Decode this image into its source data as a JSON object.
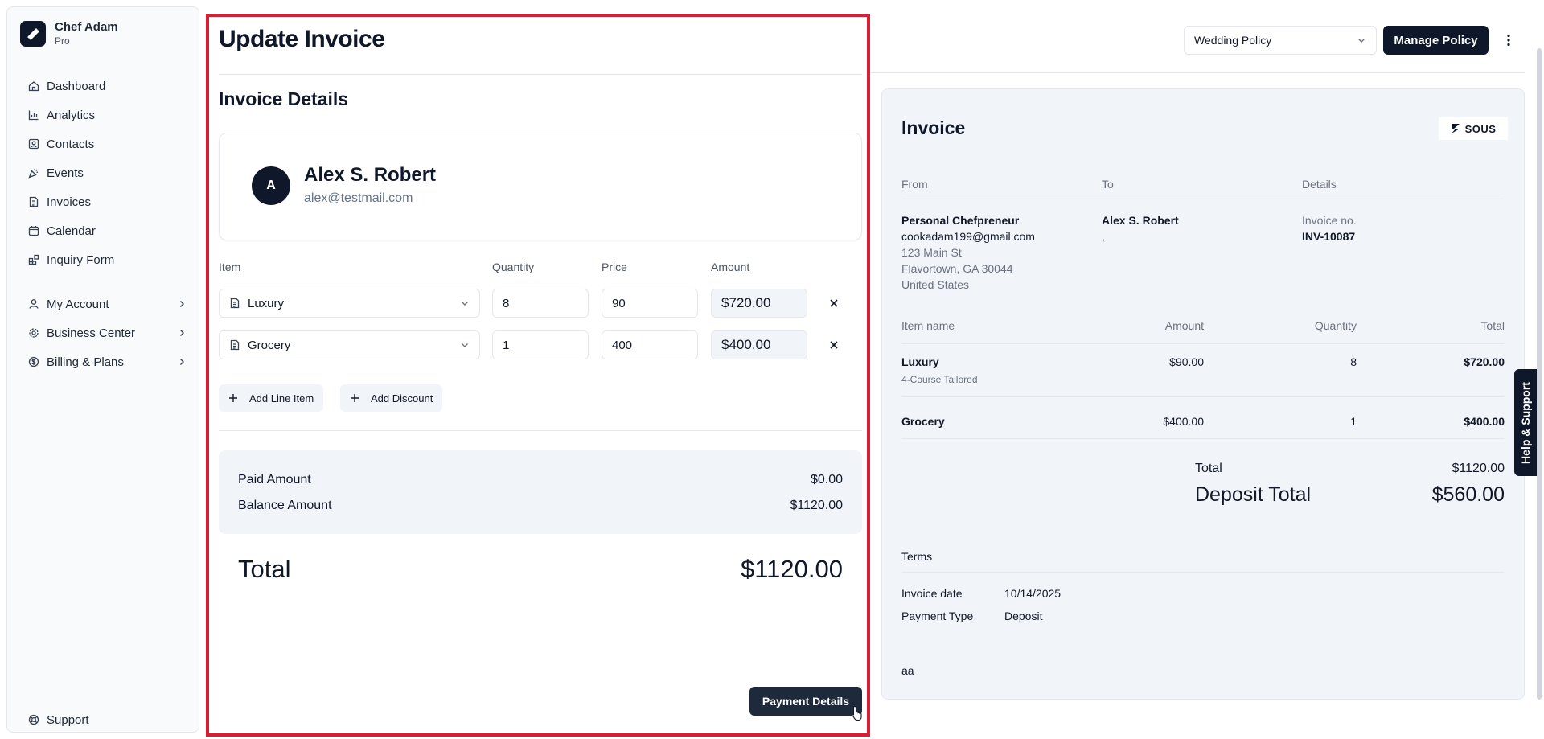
{
  "brand": {
    "name": "Chef Adam",
    "plan": "Pro"
  },
  "nav": {
    "primary": [
      {
        "label": "Dashboard",
        "icon": "home-icon"
      },
      {
        "label": "Analytics",
        "icon": "bar-chart-icon"
      },
      {
        "label": "Contacts",
        "icon": "contact-card-icon"
      },
      {
        "label": "Events",
        "icon": "party-popper-icon"
      },
      {
        "label": "Invoices",
        "icon": "document-icon"
      },
      {
        "label": "Calendar",
        "icon": "calendar-icon"
      },
      {
        "label": "Inquiry Form",
        "icon": "form-blocks-icon"
      }
    ],
    "secondary": [
      {
        "label": "My Account",
        "icon": "user-icon"
      },
      {
        "label": "Business Center",
        "icon": "gear-icon"
      },
      {
        "label": "Billing & Plans",
        "icon": "dollar-circle-icon"
      }
    ],
    "support": {
      "label": "Support",
      "icon": "lifebuoy-icon"
    }
  },
  "header": {
    "policy_select": "Wedding Policy",
    "manage_policy": "Manage Policy"
  },
  "form": {
    "title": "Update Invoice",
    "section_title": "Invoice Details",
    "client": {
      "initial": "A",
      "name": "Alex S. Robert",
      "email": "alex@testmail.com"
    },
    "columns": {
      "item": "Item",
      "quantity": "Quantity",
      "price": "Price",
      "amount": "Amount"
    },
    "lines": [
      {
        "item": "Luxury",
        "quantity": "8",
        "price": "90",
        "amount": "$720.00"
      },
      {
        "item": "Grocery",
        "quantity": "1",
        "price": "400",
        "amount": "$400.00"
      }
    ],
    "add_line_item": "Add Line Item",
    "add_discount": "Add Discount",
    "paid_label": "Paid Amount",
    "paid_value": "$0.00",
    "balance_label": "Balance Amount",
    "balance_value": "$1120.00",
    "total_label": "Total",
    "total_value": "$1120.00",
    "payment_details": "Payment Details"
  },
  "preview": {
    "title": "Invoice",
    "logo_text": "SOUS",
    "headers": {
      "from": "From",
      "to": "To",
      "details": "Details"
    },
    "from": {
      "name": "Personal Chefpreneur",
      "email": "cookadam199@gmail.com",
      "address1": "123 Main St",
      "address2": "Flavortown, GA 30044",
      "country": "United States"
    },
    "to": {
      "name": "Alex S. Robert",
      "line2": ","
    },
    "details": {
      "invoice_no_label": "Invoice no.",
      "invoice_no": "INV-10087"
    },
    "table_headers": {
      "item": "Item name",
      "amount": "Amount",
      "quantity": "Quantity",
      "total": "Total"
    },
    "rows": [
      {
        "name": "Luxury",
        "desc": "4-Course Tailored",
        "amount": "$90.00",
        "quantity": "8",
        "total": "$720.00"
      },
      {
        "name": "Grocery",
        "desc": "",
        "amount": "$400.00",
        "quantity": "1",
        "total": "$400.00"
      }
    ],
    "total_label": "Total",
    "total_value": "$1120.00",
    "deposit_label": "Deposit Total",
    "deposit_value": "$560.00",
    "terms_label": "Terms",
    "invoice_date_label": "Invoice date",
    "invoice_date": "10/14/2025",
    "payment_type_label": "Payment Type",
    "payment_type": "Deposit",
    "notes": "aa"
  },
  "help_tab": "Help & Support",
  "colors": {
    "primary": "#0f172a",
    "highlight": "#dc1c32",
    "panel": "#f1f5f9"
  }
}
